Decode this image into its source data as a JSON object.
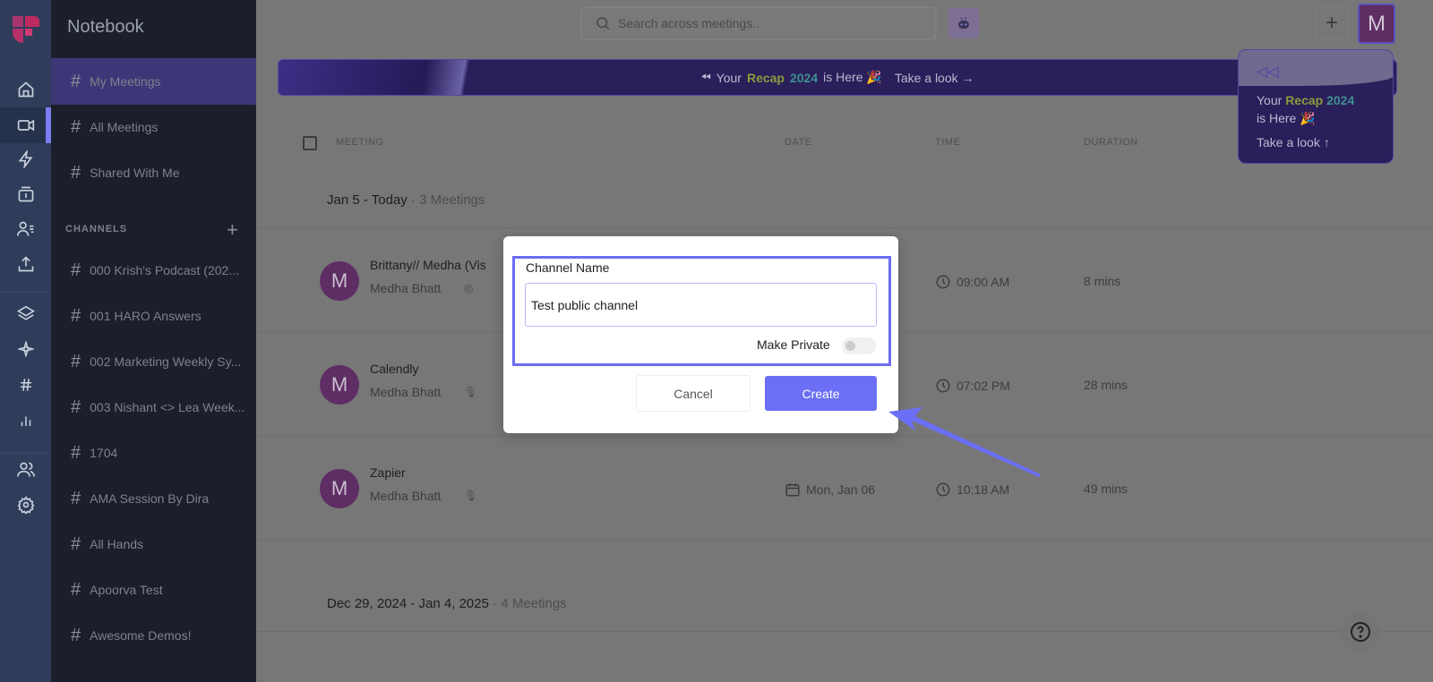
{
  "sidebar": {
    "title": "Notebook",
    "nav": [
      {
        "label": "My Meetings"
      },
      {
        "label": "All Meetings"
      },
      {
        "label": "Shared With Me"
      }
    ],
    "channels_header": "CHANNELS",
    "channels": [
      "000 Krish's Podcast (202...",
      "001 HARO Answers",
      "002 Marketing Weekly Sy...",
      "003 Nishant <> Lea Week...",
      "1704",
      "AMA Session By Dira",
      "All Hands",
      "Apoorva Test",
      "Awesome Demos!"
    ]
  },
  "header": {
    "search_placeholder": "Search across meetings..",
    "avatar": "M"
  },
  "banner": {
    "pre": "Your",
    "r1": "Recap",
    "r2": "2024",
    "post": "is Here 🎉",
    "cta": "Take a look →"
  },
  "popup": {
    "pre": "Your",
    "r1": "Recap",
    "r2": "2024",
    "post": "is Here 🎉",
    "cta": "Take a look ↑"
  },
  "table": {
    "headers": [
      "MEETING",
      "DATE",
      "TIME",
      "DURATION"
    ],
    "groups": [
      {
        "label": "Jan 5 - Today",
        "count": "3 Meetings"
      },
      {
        "label": "Dec 29, 2024 - Jan 4, 2025",
        "count": "4 Meetings"
      }
    ],
    "rows": [
      {
        "avatar": "M",
        "name": "Brittany// Medha (Vis",
        "owner": "Medha Bhatt",
        "date": "",
        "time": "09:00 AM",
        "duration": "8 mins"
      },
      {
        "avatar": "M",
        "name": "Calendly",
        "owner": "Medha Bhatt",
        "date": "",
        "time": "07:02 PM",
        "duration": "28 mins"
      },
      {
        "avatar": "M",
        "name": "Zapier",
        "owner": "Medha Bhatt",
        "date": "Mon, Jan 06",
        "time": "10:18 AM",
        "duration": "49 mins"
      }
    ]
  },
  "modal": {
    "label": "Channel Name",
    "value": "Test public channel",
    "private_label": "Make Private",
    "private": false,
    "cancel": "Cancel",
    "create": "Create"
  },
  "colors": {
    "accent": "#6b6ff5",
    "avatar": "#5e2d64"
  }
}
